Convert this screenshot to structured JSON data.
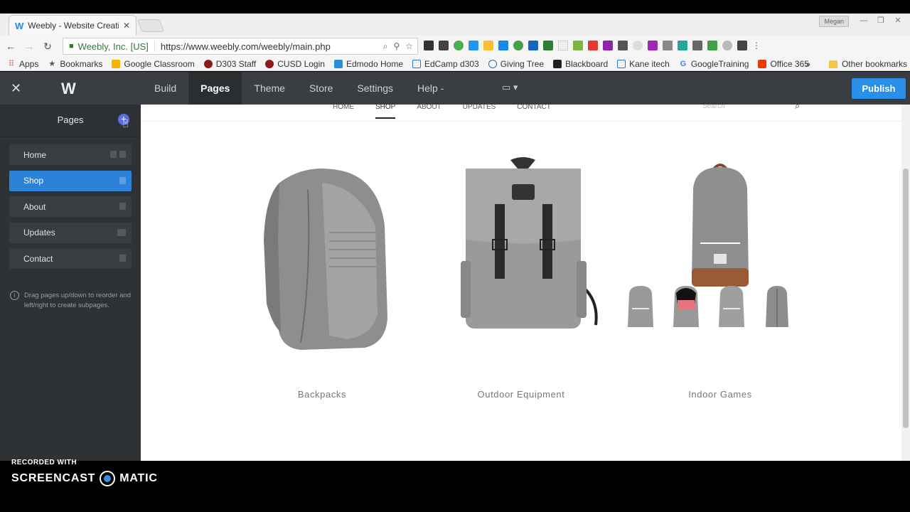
{
  "browser": {
    "tab_title": "Weebly - Website Creati",
    "profile_name": "Megan",
    "secure_label": "Weebly, Inc. [US]",
    "url": "https://www.weebly.com/weebly/main.php"
  },
  "bookmarks": [
    {
      "label": "Apps",
      "icon": "apps-grid-icon",
      "color": "#e0473a"
    },
    {
      "label": "Bookmarks",
      "icon": "star-icon",
      "color": "#555555"
    },
    {
      "label": "Google Classroom",
      "icon": "classroom-icon",
      "color": "#f4b400"
    },
    {
      "label": "D303 Staff",
      "icon": "mascot-icon",
      "color": "#8b1a1a"
    },
    {
      "label": "CUSD Login",
      "icon": "mascot-icon",
      "color": "#8b1a1a"
    },
    {
      "label": "Edmodo Home",
      "icon": "edmodo-icon",
      "color": "#2b8fd6"
    },
    {
      "label": "EdCamp d303",
      "icon": "page-icon",
      "color": "#2b6fd6"
    },
    {
      "label": "Giving Tree",
      "icon": "wordpress-icon",
      "color": "#21759b"
    },
    {
      "label": "Blackboard",
      "icon": "blackboard-icon",
      "color": "#222222"
    },
    {
      "label": "Kane itech",
      "icon": "page-icon",
      "color": "#2b6fd6"
    },
    {
      "label": "GoogleTraining",
      "icon": "google-icon",
      "color": "#4285f4"
    },
    {
      "label": "Office 365",
      "icon": "office-icon",
      "color": "#eb3c00"
    }
  ],
  "other_bookmarks": "Other bookmarks",
  "weebly_nav": {
    "tabs": [
      "Build",
      "Pages",
      "Theme",
      "Store",
      "Settings",
      "Help -"
    ],
    "active_tab": "Pages",
    "publish_label": "Publish"
  },
  "sidebar": {
    "title": "Pages",
    "pages": [
      "Home",
      "Shop",
      "About",
      "Updates",
      "Contact"
    ],
    "active_page": "Shop",
    "hint": "Drag pages up/down to reorder and left/right to create subpages."
  },
  "site": {
    "nav_links": [
      "HOME",
      "SHOP",
      "ABOUT",
      "UPDATES",
      "CONTACT"
    ],
    "active_link": "SHOP",
    "search_placeholder": "Search",
    "products": [
      {
        "caption": "Backpacks"
      },
      {
        "caption": "Outdoor Equipment"
      },
      {
        "caption": "Indoor Games"
      }
    ]
  },
  "watermark": {
    "line1": "RECORDED WITH",
    "brand_left": "SCREENCAST",
    "brand_right": "MATIC"
  }
}
